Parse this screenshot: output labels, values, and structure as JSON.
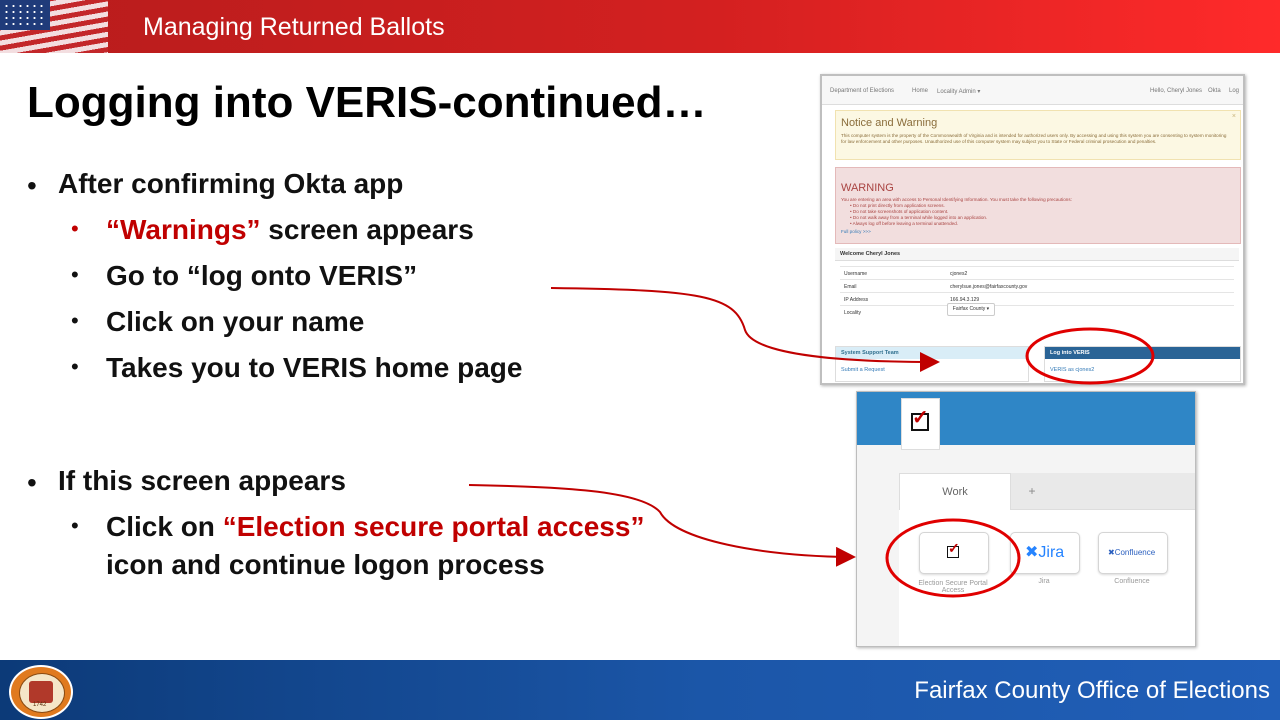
{
  "header": {
    "title": "Managing Returned Ballots"
  },
  "slide": {
    "title": "Logging into VERIS-continued…"
  },
  "bullets": {
    "b1": "After confirming Okta app",
    "b1_1_red": "“Warnings”",
    "b1_1_rest": " screen appears",
    "b1_2": "Go to “log onto VERIS”",
    "b1_3": "Click on your name",
    "b1_4": "Takes you to VERIS home page",
    "b2": "If this screen appears",
    "b2_1_pre": "Click on ",
    "b2_1_red": "“Election secure portal access”",
    "b2_1_line2": "icon and continue logon process"
  },
  "veris_screen": {
    "nav_brand": "Department of Elections",
    "nav_home": "Home",
    "nav_admin": "Locality Admin ▾",
    "nav_hello": "Hello, Cheryl Jones",
    "nav_okta": "Okta",
    "nav_log": "Log",
    "notice_title": "Notice and Warning",
    "notice_text": "This computer system is the property of the Commonwealth of Virginia and is intended for authorized users only. By accessing and using this system you are consenting to system monitoring for law enforcement and other purposes. Unauthorized use of this computer system may subject you to State or Federal criminal prosecution and penalties.",
    "warning_title": "WARNING",
    "warning_text": "You are entering an area with access to Personal Identifying Information. You must take the following precautions:",
    "warning_items": [
      "Do not print directly from application screens.",
      "Do not take screenshots of application content.",
      "Do not walk away from a terminal while logged into an application.",
      "Always log off before leaving a terminal unattended."
    ],
    "full_policy": "Full policy >>>",
    "welcome": "Welcome Cheryl Jones",
    "fields": [
      {
        "label": "Username",
        "value": "cjones2"
      },
      {
        "label": "Email",
        "value": "cherylsue.jones@fairfaxcounty.gov"
      },
      {
        "label": "IP Address",
        "value": "166.94.3.129"
      },
      {
        "label": "Locality",
        "value": ""
      }
    ],
    "locality_select": "Fairfax County ▾",
    "support_title": "System Support Team",
    "support_link": "Submit a Request",
    "login_title": "Log into VERIS",
    "login_link": "VERIS as cjones2"
  },
  "okta_screen": {
    "tab_work": "Work",
    "tab_add": "+",
    "apps": [
      {
        "label": "Election Secure Portal Access",
        "icon": "ballot-check-icon"
      },
      {
        "label": "Jira",
        "icon": "jira-icon",
        "logo_text": "Jira"
      },
      {
        "label": "Confluence",
        "icon": "confluence-icon",
        "logo_text": "Confluence"
      }
    ]
  },
  "footer": {
    "text": "Fairfax County Office of Elections",
    "seal_year": "1742"
  },
  "colors": {
    "accent_red": "#c00000",
    "header_red": "#d32020",
    "footer_blue": "#1b56a8"
  }
}
